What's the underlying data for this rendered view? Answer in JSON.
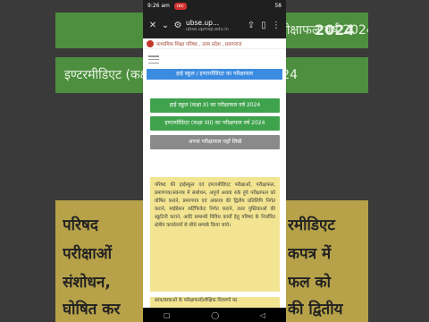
{
  "status_bar": {
    "time": "9:26 am",
    "recording_badge": "rec",
    "battery": "58"
  },
  "browser": {
    "url": "ubse.up...",
    "url_full": "ubse.upmsp.edu.in",
    "close_icon": "close-icon",
    "chevron_icon": "chevron-down-icon",
    "tune_icon": "site-settings-icon",
    "share_icon": "share-icon",
    "bookmark_icon": "bookmark-icon",
    "menu_icon": "more-vert-icon"
  },
  "site": {
    "title": "माध्यमिक शिक्षा परिषद , उत्तर प्रदेश , प्रयागराज",
    "page_title": "हाई स्कूल / इण्टरमीडिएट का परीक्षाफल"
  },
  "buttons": [
    {
      "label": "हाई स्कूल (कक्षा X) का परीक्षाफल वर्ष 2024"
    },
    {
      "label": "इण्टरमीडिएट (कक्षा XII) का परीक्षाफल वर्ष 2024"
    },
    {
      "label": "अपना परीक्षाफल यहाँ लिखें"
    }
  ],
  "notice": {
    "text": "परिषद की हाईस्कूल एवं इण्टरमीडिएट परीक्षाओं, परीक्षाफल, प्रमाणपत्र/अंकपत्र में संशोधन, अपूर्ण अथवा रुके हुये परीक्षाफल को घोषित कराने, प्रमाणपत्र एवं अंकपत्र की द्वितीय प्रतिलिपि निर्गत कराने, माईग्रेशन सर्टिफिकेट निर्गत कराने, उत्तर पुस्तिकाओं की स्क्रूटिनी कराने, आदि सम्बन्धी विविध कार्यों हेतु परिषद के निर्धारित क्षेत्रीय कार्यालयों से सीधे सम्पर्क किया जाये।",
    "second_line": "छात्र/छात्राओं के परीक्षाफलों/शैक्षिक विवरणों का"
  },
  "background": {
    "top_green_left": "हाई स्कूल (कक्षा X) का परीक्षाफल वर्ष 2024",
    "mid_green_left": "इण्टरमीडिएट (कक्षा XII) का परीक्षाफल वर्ष 2024",
    "year_right": "2024",
    "left_lines": [
      "परिषद",
      "परीक्षाओं",
      "संशोधन,",
      "घोषित कर"
    ],
    "right_lines": [
      "रमीडिएट",
      "कपत्र में",
      "फल को",
      "की द्वितीय"
    ]
  },
  "colors": {
    "green": "#3fa34d",
    "blue": "#3b8be0",
    "notice_bg": "#f2e491",
    "grey": "#8a8a8a"
  }
}
